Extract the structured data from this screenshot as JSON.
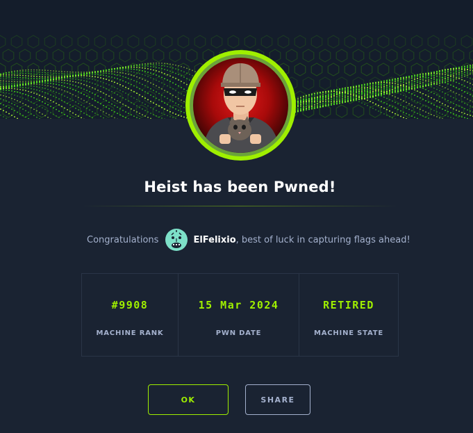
{
  "banner": {
    "icon": "hex-grid-wave-banner"
  },
  "machine": {
    "avatar_icon": "heist-thief-avatar",
    "title": "Heist has been Pwned!"
  },
  "congrats": {
    "prefix": "Congratulations",
    "user_avatar_icon": "user-avatar-icon",
    "username": "ElFelixio",
    "suffix": ", best of luck in capturing flags ahead!"
  },
  "stats": [
    {
      "value": "#9908",
      "label": "MACHINE RANK"
    },
    {
      "value": "15 Mar 2024",
      "label": "PWN DATE"
    },
    {
      "value": "RETIRED",
      "label": "MACHINE STATE"
    }
  ],
  "buttons": {
    "ok": "OK",
    "share": "SHARE"
  },
  "colors": {
    "background": "#1a2332",
    "accent": "#9fef00",
    "text_muted": "#a4b1cd",
    "text_white": "#ffffff"
  }
}
